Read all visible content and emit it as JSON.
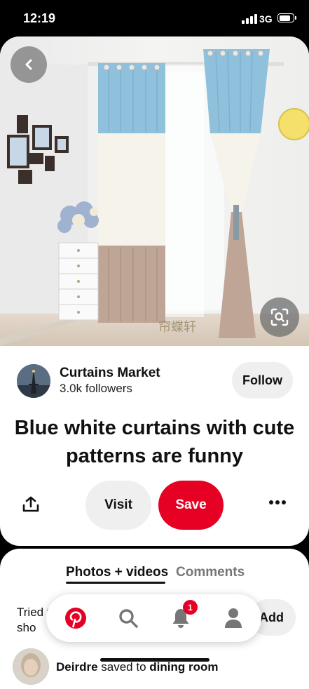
{
  "status_bar": {
    "time": "12:19",
    "network": "3G",
    "battery_level": 0.85
  },
  "pin": {
    "image_watermark": "帘蝶轩",
    "creator": {
      "name": "Curtains Market",
      "followers": "3.0k followers"
    },
    "follow_label": "Follow",
    "title": "Blue white curtains with cute patterns are funny",
    "visit_label": "Visit",
    "save_label": "Save"
  },
  "comments": {
    "tabs": [
      {
        "label": "Photos + videos"
      },
      {
        "label": "Comments"
      }
    ],
    "tried_text": "Tried to sho",
    "add_label": "Add",
    "activity": {
      "user": "Deirdre",
      "middle": " saved to ",
      "board": "dining room"
    }
  },
  "nav": {
    "notification_count": "1"
  },
  "colors": {
    "brand_red": "#e60023",
    "button_gray": "#efefef",
    "text_gray": "#767676"
  }
}
